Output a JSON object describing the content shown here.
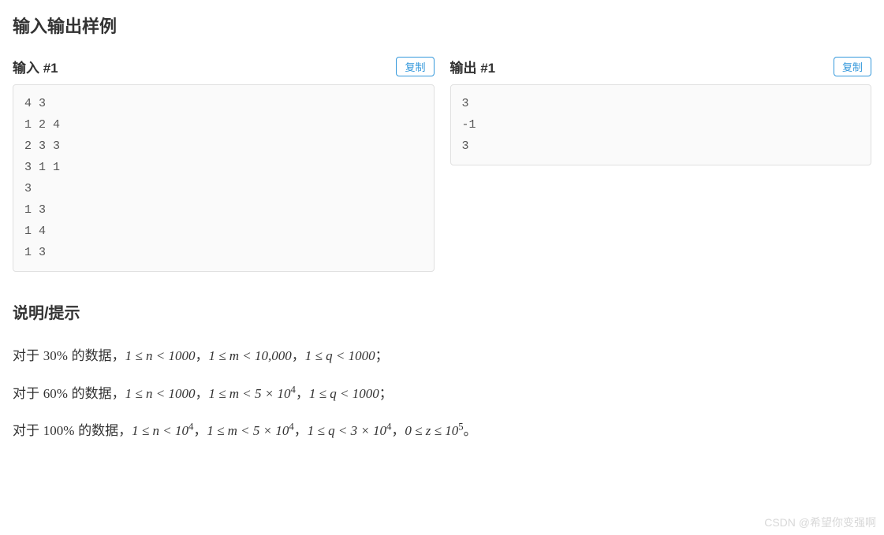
{
  "titles": {
    "io_section": "输入输出样例",
    "hints_section": "说明/提示"
  },
  "io": {
    "input": {
      "label": "输入 #1",
      "copy_label": "复制",
      "content": "4 3\n1 2 4\n2 3 3\n3 1 1\n3\n1 3\n1 4\n1 3"
    },
    "output": {
      "label": "输出 #1",
      "copy_label": "复制",
      "content": "3\n-1\n3"
    }
  },
  "hints": {
    "line1": {
      "prefix": "对于 ",
      "pct": "30%",
      "mid": " 的数据，",
      "c1": "1 ≤ n < 1000",
      "sep1": "，",
      "c2": "1 ≤ m < 10,000",
      "sep2": "，",
      "c3": "1 ≤ q < 1000",
      "tail": "；"
    },
    "line2": {
      "prefix": "对于 ",
      "pct": "60%",
      "mid": " 的数据，",
      "c1": "1 ≤ n < 1000",
      "sep1": "，",
      "c2_a": "1 ≤ m < 5 × 10",
      "c2_exp": "4",
      "sep2": "，",
      "c3": "1 ≤ q < 1000",
      "tail": "；"
    },
    "line3": {
      "prefix": "对于 ",
      "pct": "100%",
      "mid": " 的数据，",
      "c1_a": "1 ≤ n < 10",
      "c1_exp": "4",
      "sep1": "，",
      "c2_a": "1 ≤ m < 5 × 10",
      "c2_exp": "4",
      "sep2": "，",
      "c3_a": "1 ≤ q < 3 × 10",
      "c3_exp": "4",
      "sep3": "，",
      "c4_a": "0 ≤ z ≤ 10",
      "c4_exp": "5",
      "tail": "。"
    }
  },
  "watermark": "CSDN @希望你变强啊"
}
